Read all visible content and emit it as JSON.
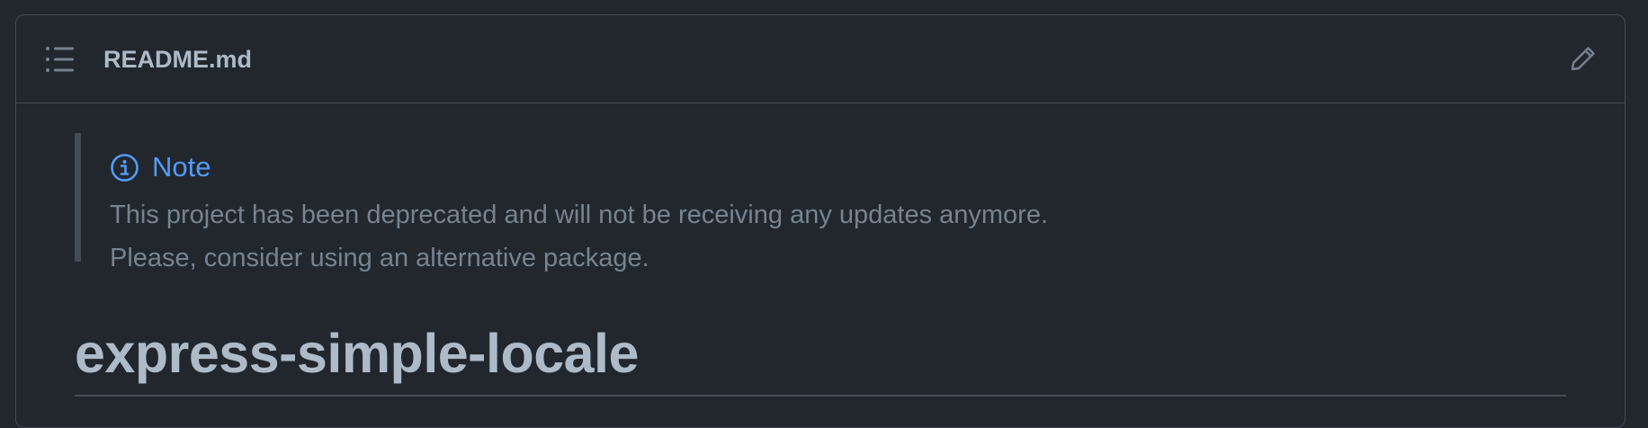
{
  "file": {
    "name": "README.md",
    "toc_icon": "list-unordered-icon",
    "edit_icon": "pencil-icon"
  },
  "note": {
    "icon": "info-icon",
    "title": "Note",
    "line1": "This project has been deprecated and will not be receiving any updates anymore.",
    "line2": "Please, consider using an alternative package."
  },
  "heading": {
    "text": "express-simple-locale"
  },
  "colors": {
    "background": "#22272e",
    "border": "#444c56",
    "note_accent": "#539bf5",
    "text_muted": "#768390",
    "text_primary": "#adbac7"
  }
}
